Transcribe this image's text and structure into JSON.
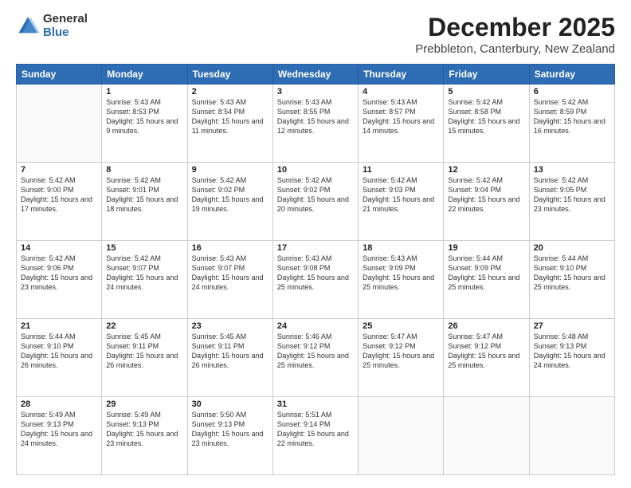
{
  "logo": {
    "general": "General",
    "blue": "Blue"
  },
  "header": {
    "month": "December 2025",
    "location": "Prebbleton, Canterbury, New Zealand"
  },
  "weekdays": [
    "Sunday",
    "Monday",
    "Tuesday",
    "Wednesday",
    "Thursday",
    "Friday",
    "Saturday"
  ],
  "weeks": [
    [
      {
        "day": "",
        "sunrise": "",
        "sunset": "",
        "daylight": ""
      },
      {
        "day": "1",
        "sunrise": "Sunrise: 5:43 AM",
        "sunset": "Sunset: 8:53 PM",
        "daylight": "Daylight: 15 hours and 9 minutes."
      },
      {
        "day": "2",
        "sunrise": "Sunrise: 5:43 AM",
        "sunset": "Sunset: 8:54 PM",
        "daylight": "Daylight: 15 hours and 11 minutes."
      },
      {
        "day": "3",
        "sunrise": "Sunrise: 5:43 AM",
        "sunset": "Sunset: 8:55 PM",
        "daylight": "Daylight: 15 hours and 12 minutes."
      },
      {
        "day": "4",
        "sunrise": "Sunrise: 5:43 AM",
        "sunset": "Sunset: 8:57 PM",
        "daylight": "Daylight: 15 hours and 14 minutes."
      },
      {
        "day": "5",
        "sunrise": "Sunrise: 5:42 AM",
        "sunset": "Sunset: 8:58 PM",
        "daylight": "Daylight: 15 hours and 15 minutes."
      },
      {
        "day": "6",
        "sunrise": "Sunrise: 5:42 AM",
        "sunset": "Sunset: 8:59 PM",
        "daylight": "Daylight: 15 hours and 16 minutes."
      }
    ],
    [
      {
        "day": "7",
        "sunrise": "Sunrise: 5:42 AM",
        "sunset": "Sunset: 9:00 PM",
        "daylight": "Daylight: 15 hours and 17 minutes."
      },
      {
        "day": "8",
        "sunrise": "Sunrise: 5:42 AM",
        "sunset": "Sunset: 9:01 PM",
        "daylight": "Daylight: 15 hours and 18 minutes."
      },
      {
        "day": "9",
        "sunrise": "Sunrise: 5:42 AM",
        "sunset": "Sunset: 9:02 PM",
        "daylight": "Daylight: 15 hours and 19 minutes."
      },
      {
        "day": "10",
        "sunrise": "Sunrise: 5:42 AM",
        "sunset": "Sunset: 9:02 PM",
        "daylight": "Daylight: 15 hours and 20 minutes."
      },
      {
        "day": "11",
        "sunrise": "Sunrise: 5:42 AM",
        "sunset": "Sunset: 9:03 PM",
        "daylight": "Daylight: 15 hours and 21 minutes."
      },
      {
        "day": "12",
        "sunrise": "Sunrise: 5:42 AM",
        "sunset": "Sunset: 9:04 PM",
        "daylight": "Daylight: 15 hours and 22 minutes."
      },
      {
        "day": "13",
        "sunrise": "Sunrise: 5:42 AM",
        "sunset": "Sunset: 9:05 PM",
        "daylight": "Daylight: 15 hours and 23 minutes."
      }
    ],
    [
      {
        "day": "14",
        "sunrise": "Sunrise: 5:42 AM",
        "sunset": "Sunset: 9:06 PM",
        "daylight": "Daylight: 15 hours and 23 minutes."
      },
      {
        "day": "15",
        "sunrise": "Sunrise: 5:42 AM",
        "sunset": "Sunset: 9:07 PM",
        "daylight": "Daylight: 15 hours and 24 minutes."
      },
      {
        "day": "16",
        "sunrise": "Sunrise: 5:43 AM",
        "sunset": "Sunset: 9:07 PM",
        "daylight": "Daylight: 15 hours and 24 minutes."
      },
      {
        "day": "17",
        "sunrise": "Sunrise: 5:43 AM",
        "sunset": "Sunset: 9:08 PM",
        "daylight": "Daylight: 15 hours and 25 minutes."
      },
      {
        "day": "18",
        "sunrise": "Sunrise: 5:43 AM",
        "sunset": "Sunset: 9:09 PM",
        "daylight": "Daylight: 15 hours and 25 minutes."
      },
      {
        "day": "19",
        "sunrise": "Sunrise: 5:44 AM",
        "sunset": "Sunset: 9:09 PM",
        "daylight": "Daylight: 15 hours and 25 minutes."
      },
      {
        "day": "20",
        "sunrise": "Sunrise: 5:44 AM",
        "sunset": "Sunset: 9:10 PM",
        "daylight": "Daylight: 15 hours and 25 minutes."
      }
    ],
    [
      {
        "day": "21",
        "sunrise": "Sunrise: 5:44 AM",
        "sunset": "Sunset: 9:10 PM",
        "daylight": "Daylight: 15 hours and 26 minutes."
      },
      {
        "day": "22",
        "sunrise": "Sunrise: 5:45 AM",
        "sunset": "Sunset: 9:11 PM",
        "daylight": "Daylight: 15 hours and 26 minutes."
      },
      {
        "day": "23",
        "sunrise": "Sunrise: 5:45 AM",
        "sunset": "Sunset: 9:11 PM",
        "daylight": "Daylight: 15 hours and 26 minutes."
      },
      {
        "day": "24",
        "sunrise": "Sunrise: 5:46 AM",
        "sunset": "Sunset: 9:12 PM",
        "daylight": "Daylight: 15 hours and 25 minutes."
      },
      {
        "day": "25",
        "sunrise": "Sunrise: 5:47 AM",
        "sunset": "Sunset: 9:12 PM",
        "daylight": "Daylight: 15 hours and 25 minutes."
      },
      {
        "day": "26",
        "sunrise": "Sunrise: 5:47 AM",
        "sunset": "Sunset: 9:12 PM",
        "daylight": "Daylight: 15 hours and 25 minutes."
      },
      {
        "day": "27",
        "sunrise": "Sunrise: 5:48 AM",
        "sunset": "Sunset: 9:13 PM",
        "daylight": "Daylight: 15 hours and 24 minutes."
      }
    ],
    [
      {
        "day": "28",
        "sunrise": "Sunrise: 5:49 AM",
        "sunset": "Sunset: 9:13 PM",
        "daylight": "Daylight: 15 hours and 24 minutes."
      },
      {
        "day": "29",
        "sunrise": "Sunrise: 5:49 AM",
        "sunset": "Sunset: 9:13 PM",
        "daylight": "Daylight: 15 hours and 23 minutes."
      },
      {
        "day": "30",
        "sunrise": "Sunrise: 5:50 AM",
        "sunset": "Sunset: 9:13 PM",
        "daylight": "Daylight: 15 hours and 23 minutes."
      },
      {
        "day": "31",
        "sunrise": "Sunrise: 5:51 AM",
        "sunset": "Sunset: 9:14 PM",
        "daylight": "Daylight: 15 hours and 22 minutes."
      },
      {
        "day": "",
        "sunrise": "",
        "sunset": "",
        "daylight": ""
      },
      {
        "day": "",
        "sunrise": "",
        "sunset": "",
        "daylight": ""
      },
      {
        "day": "",
        "sunrise": "",
        "sunset": "",
        "daylight": ""
      }
    ]
  ]
}
